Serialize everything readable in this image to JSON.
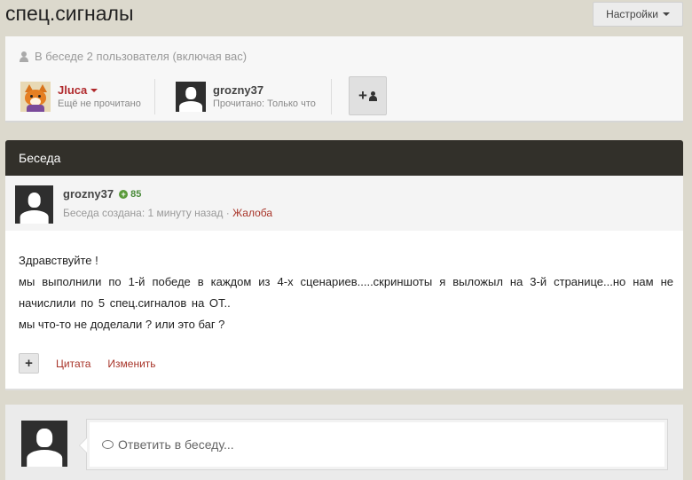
{
  "page": {
    "title": "спец.сигналы",
    "settings_label": "Настройки"
  },
  "participants": {
    "info": "В беседе 2 пользователя (включая вас)",
    "users": [
      {
        "name": "Jluca",
        "status": "Ещё не прочитано"
      },
      {
        "name": "grozny37",
        "status": "Прочитано: Только что"
      }
    ],
    "add_user_label": "+"
  },
  "conversation": {
    "header": "Беседа"
  },
  "message": {
    "author": "grozny37",
    "reputation": "85",
    "meta_created": "Беседа создана: 1 минуту назад",
    "meta_separator": " · ",
    "report_label": "Жалоба",
    "lines": [
      "Здравствуйте !",
      "мы выполнили по 1-й победе в каждом из 4-х сценариев.....скриншоты я выложыл на 3-й странице...но нам не начислили по 5 спец.сигналов на ОТ..",
      "мы что-то не доделали ? или это баг ?"
    ],
    "plus_label": "+",
    "quote_label": "Цитата",
    "edit_label": "Изменить"
  },
  "reply": {
    "placeholder": "Ответить в беседу..."
  },
  "colors": {
    "background": "#dcd9cd",
    "header_bar": "#32302a",
    "link": "#a8352a",
    "username_red": "#b0292c",
    "reputation_green": "#4a8a3a"
  },
  "icons": [
    "user-icon",
    "caret-down-icon",
    "add-user-icon",
    "reputation-plus-icon",
    "comment-icon"
  ]
}
